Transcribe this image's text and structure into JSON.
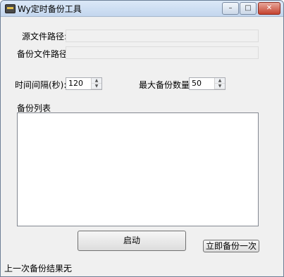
{
  "window": {
    "title": "Wy定时备份工具",
    "controls": {
      "minimize": "–",
      "maximize": "□",
      "close": "✕"
    }
  },
  "form": {
    "source_label": "源文件路径:",
    "source_value": "",
    "backup_label": "备份文件路径:",
    "backup_value": "",
    "interval_label": "时间间隔(秒):",
    "interval_value": "120",
    "max_label": "最大备份数量:",
    "max_value": "50",
    "list_label": "备份列表"
  },
  "buttons": {
    "start": "启动",
    "backup_now": "立即备份一次"
  },
  "status": {
    "label": "上一次备份结果:",
    "value": "无"
  },
  "spinner": {
    "up": "▲",
    "down": "▼"
  },
  "icons": [
    "app-icon",
    "minimize-icon",
    "maximize-icon",
    "close-icon",
    "spin-up-icon",
    "spin-down-icon"
  ]
}
